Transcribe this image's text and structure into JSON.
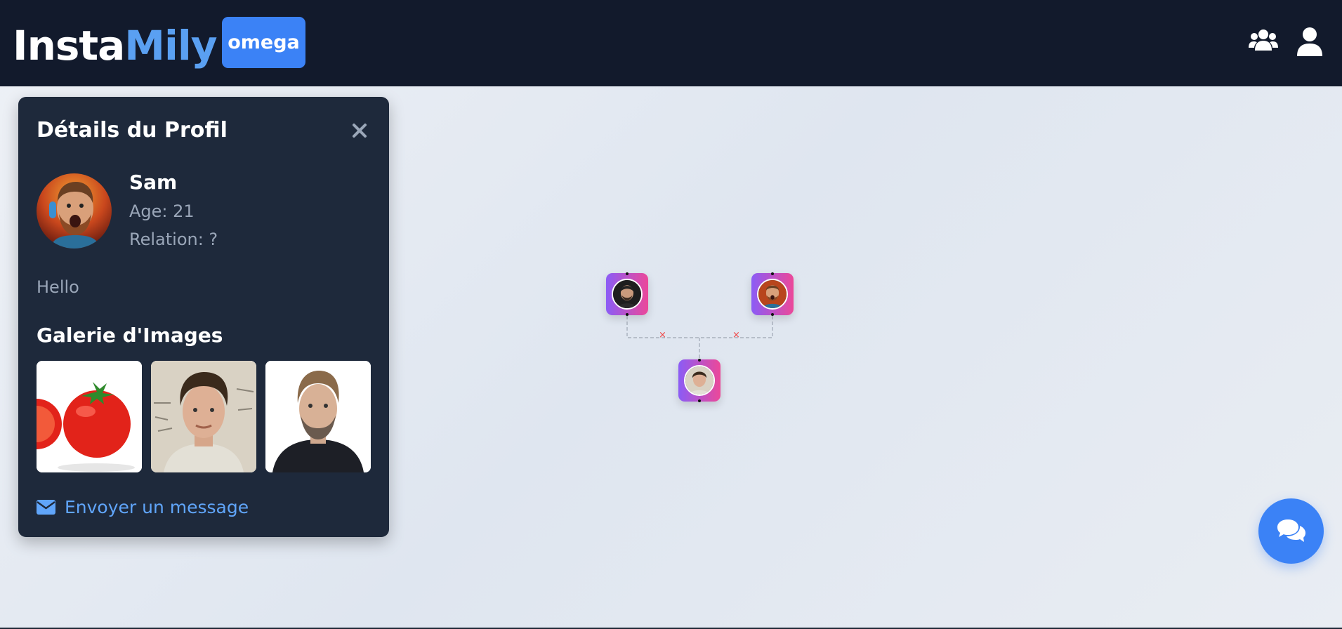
{
  "header": {
    "logo_part1": "Insta",
    "logo_part2": "Mily",
    "team_label": "omega",
    "icons": [
      "users-icon",
      "user-icon"
    ]
  },
  "profile_panel": {
    "title": "Détails du Profil",
    "name": "Sam",
    "age": "Age: 21",
    "relation": "Relation: ?",
    "bio": "Hello",
    "gallery_title": "Galerie d'Images",
    "gallery_images": [
      "tomato",
      "man-portrait",
      "bearded-man-portrait"
    ],
    "message_label": "Envoyer un message"
  },
  "tree": {
    "nodes": [
      "parent-left",
      "parent-right",
      "child"
    ],
    "link_marker": "×"
  },
  "colors": {
    "header_bg": "#121a2c",
    "accent": "#3b82f6",
    "logo_accent": "#5aa0f2",
    "panel_bg": "#1e293b",
    "link": "#60a5fa",
    "node_gradient_start": "#8b5cf6",
    "node_gradient_end": "#ec4899",
    "link_marker": "#ef4444"
  }
}
